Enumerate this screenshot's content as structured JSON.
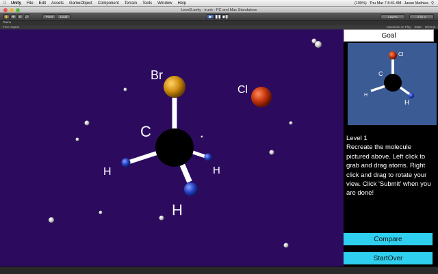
{
  "menubar": {
    "apple_icon": "apple-icon",
    "app_name": "Unity",
    "items": [
      "File",
      "Edit",
      "Assets",
      "GameObject",
      "Component",
      "Terrain",
      "Tools",
      "Window",
      "Help"
    ],
    "battery": "(100%)",
    "datetime": "Thu Mar 7  8:41 AM",
    "user": "Jason Mathias"
  },
  "window": {
    "title": "Level3.unity - trunk - PC and Mac Standalone"
  },
  "toolbar": {
    "pivot_label": "Pivot",
    "local_label": "Local",
    "layers_label": "Layers",
    "layout_label": "2 by 3"
  },
  "game_tab": {
    "label": "Game",
    "aspect": "Free Aspect",
    "maximize_label": "Maximize on Play",
    "stats_label": "Stats",
    "gizmos_label": "Gizmos"
  },
  "scene": {
    "labels": {
      "br": "Br",
      "cl": "Cl",
      "c": "C",
      "h_left": "H",
      "h_right": "H",
      "h_bottom": "H"
    },
    "colors": {
      "background": "#2c0b5f",
      "carbon": "#000000",
      "bromine": "#d18f12",
      "chlorine": "#c8360f",
      "hydrogen": "#2a45c8",
      "bond": "#ffffff"
    }
  },
  "goal": {
    "button_label": "Goal",
    "labels": {
      "cl": "Cl",
      "c": "C",
      "h_left": "H",
      "h_right": "H"
    },
    "background": "#3b5b94"
  },
  "instructions": {
    "level": "Level 1",
    "text": "Recreate the molecule pictured above. Left click to grab and drag atoms. Right click and drag to rotate your view. Click 'Submit' when you are done!"
  },
  "buttons": {
    "compare": "Compare",
    "startover": "StartOver",
    "accent": "#2fd0ef"
  }
}
